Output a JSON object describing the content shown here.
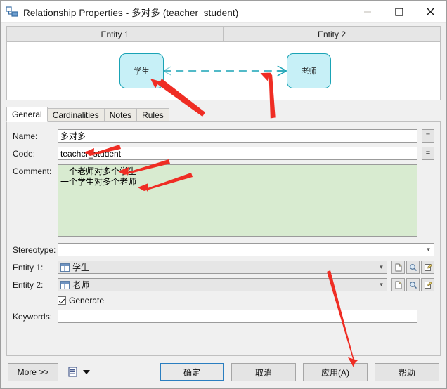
{
  "window": {
    "title": "Relationship Properties - 多对多 (teacher_student)",
    "icon": "relationship-icon",
    "controls": {
      "minimize": "minimize-icon",
      "maximize": "maximize-icon",
      "close": "close-icon"
    }
  },
  "preview": {
    "headers": [
      "Entity 1",
      "Entity 2"
    ],
    "entity_left": "学生",
    "entity_right": "老师",
    "link_style": "dashed",
    "link_color": "#19a3b5",
    "entity_fill": "#c7f0f7",
    "entity_border": "#19a3b5"
  },
  "tabs": [
    {
      "label": "General",
      "active": true
    },
    {
      "label": "Cardinalities",
      "active": false
    },
    {
      "label": "Notes",
      "active": false
    },
    {
      "label": "Rules",
      "active": false
    }
  ],
  "form": {
    "name": {
      "label": "Name:",
      "value": "多对多",
      "placeholder": ""
    },
    "code": {
      "label": "Code:",
      "value": "teacher_student",
      "placeholder": ""
    },
    "comment": {
      "label": "Comment:",
      "value": "一个老师对多个学生\n一个学生对多个老师",
      "placeholder": ""
    },
    "stereotype": {
      "label": "Stereotype:",
      "value": "",
      "placeholder": ""
    },
    "entity1": {
      "label": "Entity 1:",
      "value": "学生"
    },
    "entity2": {
      "label": "Entity 2:",
      "value": "老师"
    },
    "generate": {
      "label": "Generate",
      "checked": true
    },
    "keywords": {
      "label": "Keywords:",
      "value": "",
      "placeholder": ""
    },
    "equals_button_label": "=",
    "side_buttons": [
      "new-document-icon",
      "magnifier-icon",
      "edit-document-icon"
    ]
  },
  "footer": {
    "more": "More >>",
    "report_icon": "report-icon",
    "dropdown_icon": "caret-down-icon",
    "ok": "确定",
    "cancel": "取消",
    "apply": "应用(A)",
    "help": "帮助"
  },
  "annotations": {
    "arrow_color": "#ef2d24",
    "count": 5
  }
}
